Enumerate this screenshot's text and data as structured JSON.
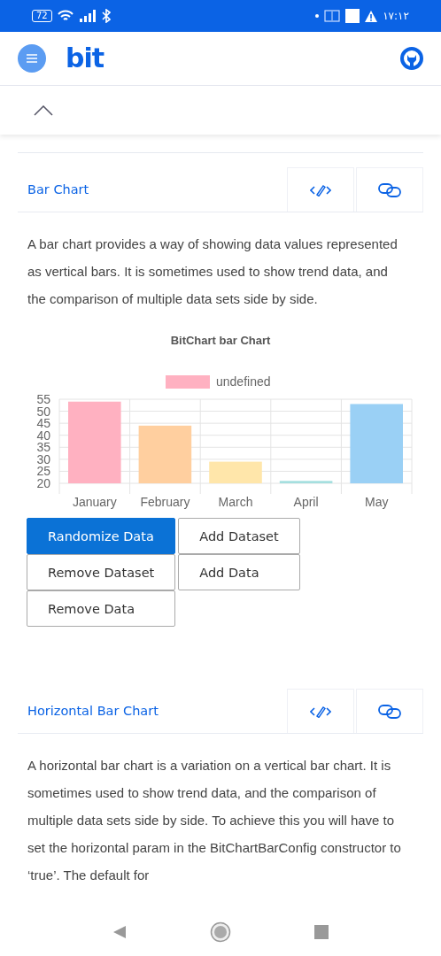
{
  "status_bar": {
    "battery": "72",
    "time": "١٧:١٢"
  },
  "header": {
    "logo": "bit"
  },
  "sections": [
    {
      "title": "Bar Chart",
      "description": "A bar chart provides a way of showing data values represented as vertical bars. It is sometimes used to show trend data, and the comparison of multiple data sets side by side.",
      "chart_data": {
        "type": "bar",
        "title": "BitChart bar Chart",
        "categories": [
          "January",
          "February",
          "March",
          "April",
          "May"
        ],
        "series": [
          {
            "name": "undefined",
            "color": [
              "#ffb1c1",
              "#ffcf9f",
              "#ffe6aa",
              "#a5dfdf",
              "#9ad0f5"
            ],
            "values": [
              54,
              44,
              29,
              21,
              53
            ]
          }
        ],
        "grid": true,
        "ylim": [
          20,
          55
        ],
        "yticks": [
          20,
          25,
          30,
          35,
          40,
          45,
          50,
          55
        ]
      },
      "buttons": [
        {
          "label": "Randomize Data",
          "selected": true
        },
        {
          "label": "Add Dataset",
          "selected": false
        },
        {
          "label": "Remove Dataset",
          "selected": false
        },
        {
          "label": "Add Data",
          "selected": false
        },
        {
          "label": "Remove Data",
          "selected": false
        }
      ]
    },
    {
      "title": "Horizontal Bar Chart",
      "description": "A horizontal bar chart is a variation on a vertical bar chart. It is sometimes used to show trend data, and the comparison of multiple data sets side by side. To achieve this you will have to set the horizontal param in the BitChartBarConfig constructor to ‘true’. The default for"
    }
  ]
}
